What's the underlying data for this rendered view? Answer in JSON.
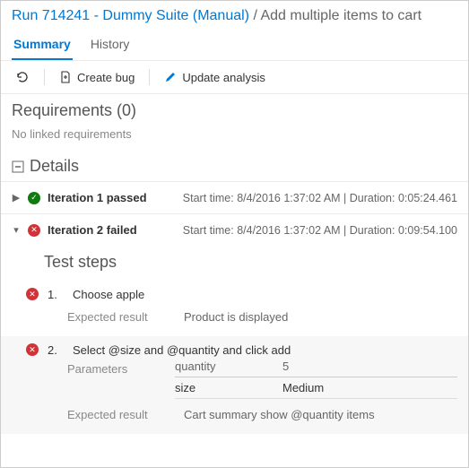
{
  "breadcrumb": {
    "run_link": "Run 714241 - Dummy Suite (Manual)",
    "sep": " / ",
    "current": "Add multiple items to cart"
  },
  "tabs": {
    "summary": "Summary",
    "history": "History"
  },
  "toolbar": {
    "create_bug": "Create bug",
    "update_analysis": "Update analysis"
  },
  "requirements": {
    "title": "Requirements (0)",
    "empty": "No linked requirements"
  },
  "details": {
    "title": "Details"
  },
  "iterations": [
    {
      "title": "Iteration 1 passed",
      "status": "pass",
      "expanded": false,
      "meta": "Start time: 8/4/2016 1:37:02 AM | Duration: 0:05:24.461"
    },
    {
      "title": "Iteration 2 failed",
      "status": "fail",
      "expanded": true,
      "meta": "Start time: 8/4/2016 1:37:02 AM | Duration: 0:09:54.100"
    }
  ],
  "test_steps_title": "Test steps",
  "steps": [
    {
      "num": "1.",
      "text": "Choose apple",
      "expected_label": "Expected result",
      "expected": "Product is displayed"
    },
    {
      "num": "2.",
      "text": "Select @size and @quantity and click add",
      "params_label": "Parameters",
      "params_headers": [
        "quantity",
        "5"
      ],
      "params_row": [
        "size",
        "Medium"
      ],
      "expected_label": "Expected result",
      "expected": "Cart summary show @quantity items"
    }
  ]
}
